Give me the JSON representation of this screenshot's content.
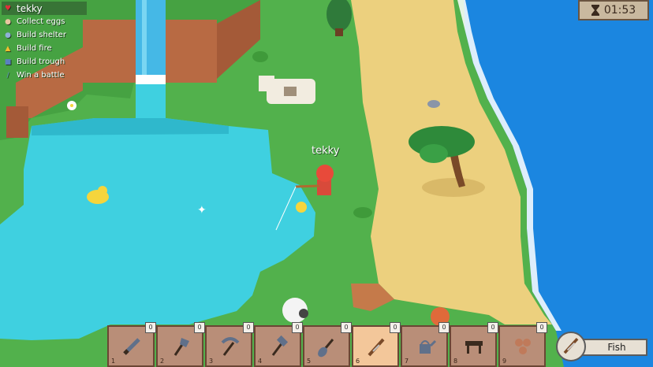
{
  "quests": [
    {
      "label": "tekky",
      "icon": "heart-icon",
      "active": true
    },
    {
      "label": "Collect eggs",
      "icon": "egg-icon"
    },
    {
      "label": "Build shelter",
      "icon": "shelter-icon"
    },
    {
      "label": "Build fire",
      "icon": "fire-icon"
    },
    {
      "label": "Build trough",
      "icon": "trough-icon"
    },
    {
      "label": "Win a battle",
      "icon": "sword-icon"
    }
  ],
  "timer": {
    "value": "01:53",
    "icon": "hourglass-icon"
  },
  "player": {
    "name": "tekky"
  },
  "hotbar": {
    "selected_slot": 6,
    "slots": [
      {
        "number": "1",
        "count": "0",
        "item": "sword-icon"
      },
      {
        "number": "2",
        "count": "0",
        "item": "axe-icon"
      },
      {
        "number": "3",
        "count": "0",
        "item": "pickaxe-icon"
      },
      {
        "number": "4",
        "count": "0",
        "item": "hammer-icon"
      },
      {
        "number": "5",
        "count": "0",
        "item": "shovel-icon"
      },
      {
        "number": "6",
        "count": "0",
        "item": "fishing-rod-icon"
      },
      {
        "number": "7",
        "count": "0",
        "item": "watering-can-icon"
      },
      {
        "number": "8",
        "count": "0",
        "item": "trough-icon"
      },
      {
        "number": "9",
        "count": "0",
        "item": "seeds-icon"
      }
    ]
  },
  "action": {
    "label": "Fish",
    "icon": "fishing-rod-icon"
  },
  "colors": {
    "grass": "#4fae4a",
    "water": "#3fd0e0",
    "ocean": "#1b86e0",
    "sand": "#ecd07e",
    "dirt": "#b86a43"
  }
}
